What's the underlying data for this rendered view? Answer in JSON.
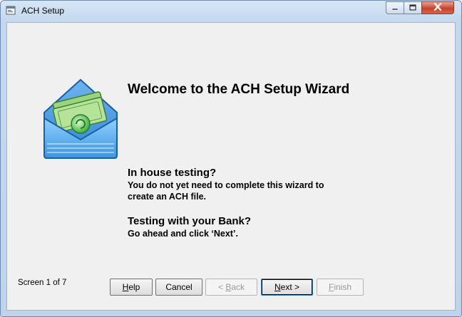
{
  "window": {
    "title": "ACH Setup",
    "app_icon": "app-window-icon",
    "controls": {
      "minimize_icon": "minimize-icon",
      "maximize_icon": "maximize-icon",
      "close_icon": "close-icon"
    }
  },
  "wizard": {
    "logo_icon": "money-envelope-icon",
    "heading": "Welcome to the ACH Setup Wizard",
    "section1": {
      "title": "In house testing?",
      "line1": "You do not yet need to complete this wizard to",
      "line2": "create an ACH file."
    },
    "section2": {
      "title": "Testing with your Bank?",
      "line1": "Go ahead and click ‘Next’."
    },
    "screen_count": "Screen 1 of 7"
  },
  "buttons": {
    "help": {
      "first": "H",
      "rest": "elp"
    },
    "cancel": "Cancel",
    "back": {
      "prefix": "< ",
      "first": "B",
      "rest": "ack"
    },
    "next": {
      "first": "N",
      "rest": "ext >"
    },
    "finish": {
      "first": "F",
      "rest": "inish"
    }
  }
}
